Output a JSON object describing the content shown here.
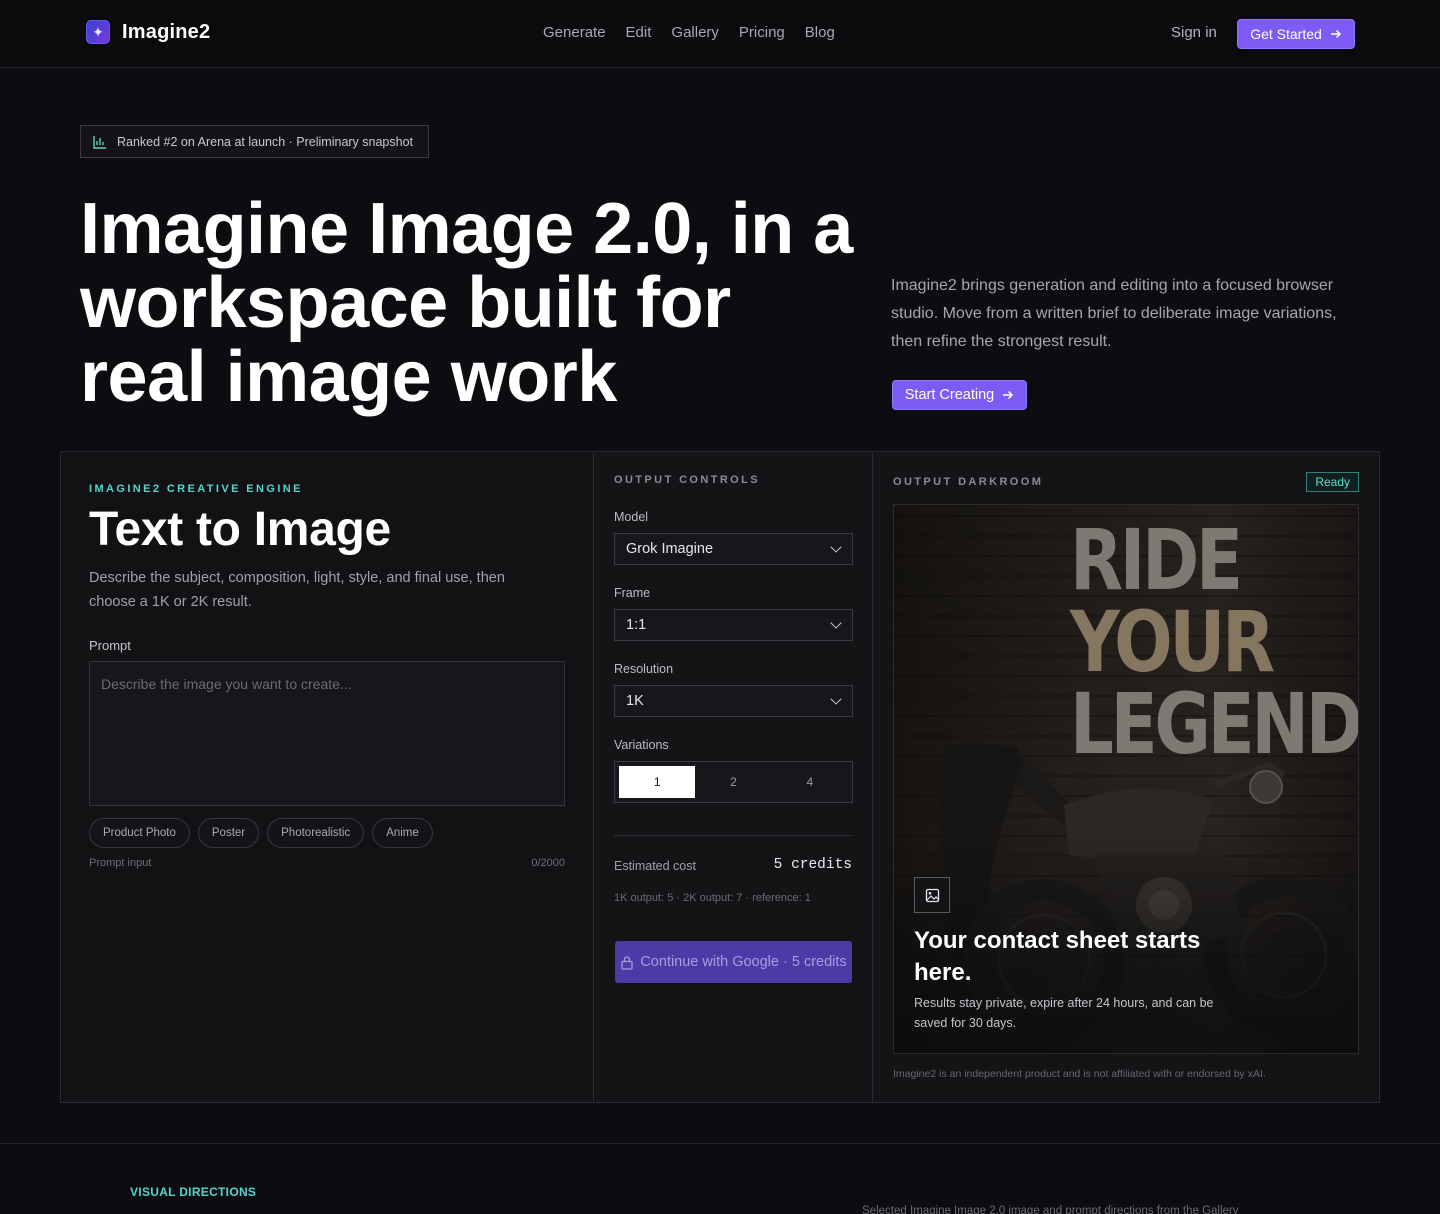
{
  "header": {
    "brand": "Imagine2",
    "nav": [
      "Generate",
      "Edit",
      "Gallery",
      "Pricing",
      "Blog"
    ],
    "sign_in": "Sign in",
    "get_started": "Get Started"
  },
  "hero": {
    "badge": "Ranked #2 on Arena at launch · Preliminary snapshot",
    "title": "Imagine Image 2.0, in a workspace built for real image work",
    "subtitle": "Imagine2 brings generation and editing into a focused browser studio. Move from a written brief to deliberate image variations, then refine the strongest result.",
    "cta": "Start Creating"
  },
  "editor": {
    "eyebrow": "IMAGINE2 CREATIVE ENGINE",
    "title": "Text to Image",
    "description": "Describe the subject, composition, light, style, and final use, then choose a 1K or 2K result.",
    "prompt_label": "Prompt",
    "prompt_placeholder": "Describe the image you want to create...",
    "prompt_value": "",
    "chips": [
      "Product Photo",
      "Poster",
      "Photorealistic",
      "Anime"
    ],
    "prompt_hint": "Prompt input",
    "char_count": "0/2000"
  },
  "controls": {
    "eyebrow": "OUTPUT CONTROLS",
    "model_label": "Model",
    "model_value": "Grok Imagine",
    "frame_label": "Frame",
    "frame_value": "1:1",
    "resolution_label": "Resolution",
    "resolution_value": "1K",
    "variations_label": "Variations",
    "variations": [
      "1",
      "2",
      "4"
    ],
    "variations_selected": "1",
    "cost_label": "Estimated cost",
    "cost_value": "5 credits",
    "cost_note": "1K output: 5 · 2K output: 7 · reference: 1",
    "continue": "Continue with Google · 5 credits"
  },
  "darkroom": {
    "eyebrow": "OUTPUT DARKROOM",
    "status": "Ready",
    "poster_lines": [
      "RIDE",
      "YOUR",
      "LEGEND"
    ],
    "overlay_title": "Your contact sheet starts here.",
    "overlay_sub": "Results stay private, expire after 24 hours, and can be saved for 30 days.",
    "disclaimer": "Imagine2 is an independent product and is not affiliated with or endorsed by xAI."
  },
  "bottom": {
    "eyebrow": "VISUAL DIRECTIONS",
    "note": "Selected Imagine Image 2.0 image and prompt directions from the Gallery"
  },
  "colors": {
    "accent": "#7c5cf5",
    "teal": "#58d4ce",
    "background": "#0d0d11"
  },
  "icons": [
    "sparkle-logo-icon",
    "arrow-right-icon",
    "bar-chart-icon",
    "chevron-down-icon",
    "lock-icon",
    "image-icon"
  ]
}
